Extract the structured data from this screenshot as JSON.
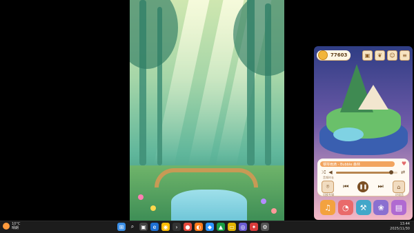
{
  "coins": "77603",
  "player": {
    "track": "钢琴雨滴 - Bubble 森林",
    "sub_label": "音频时长",
    "left_label": "切换专辑",
    "right_label": "环境音"
  },
  "taskbar": {
    "temp": "10°C",
    "weather": "晴朗",
    "time": "13:44",
    "date": "2025/11/30"
  },
  "icons": {
    "top": [
      "image-icon",
      "leaf-icon",
      "cat-icon",
      "menu-icon"
    ],
    "dock": [
      "music-note-icon",
      "tomato-timer-icon",
      "hammer-icon",
      "paw-icon",
      "notes-icon"
    ]
  },
  "colors": {
    "accent": "#f2a45f",
    "brown": "#7a4f23",
    "dock": [
      "#f3a23f",
      "#e96a6a",
      "#42a7c9",
      "#8a6fd0",
      "#b06ad1"
    ]
  }
}
